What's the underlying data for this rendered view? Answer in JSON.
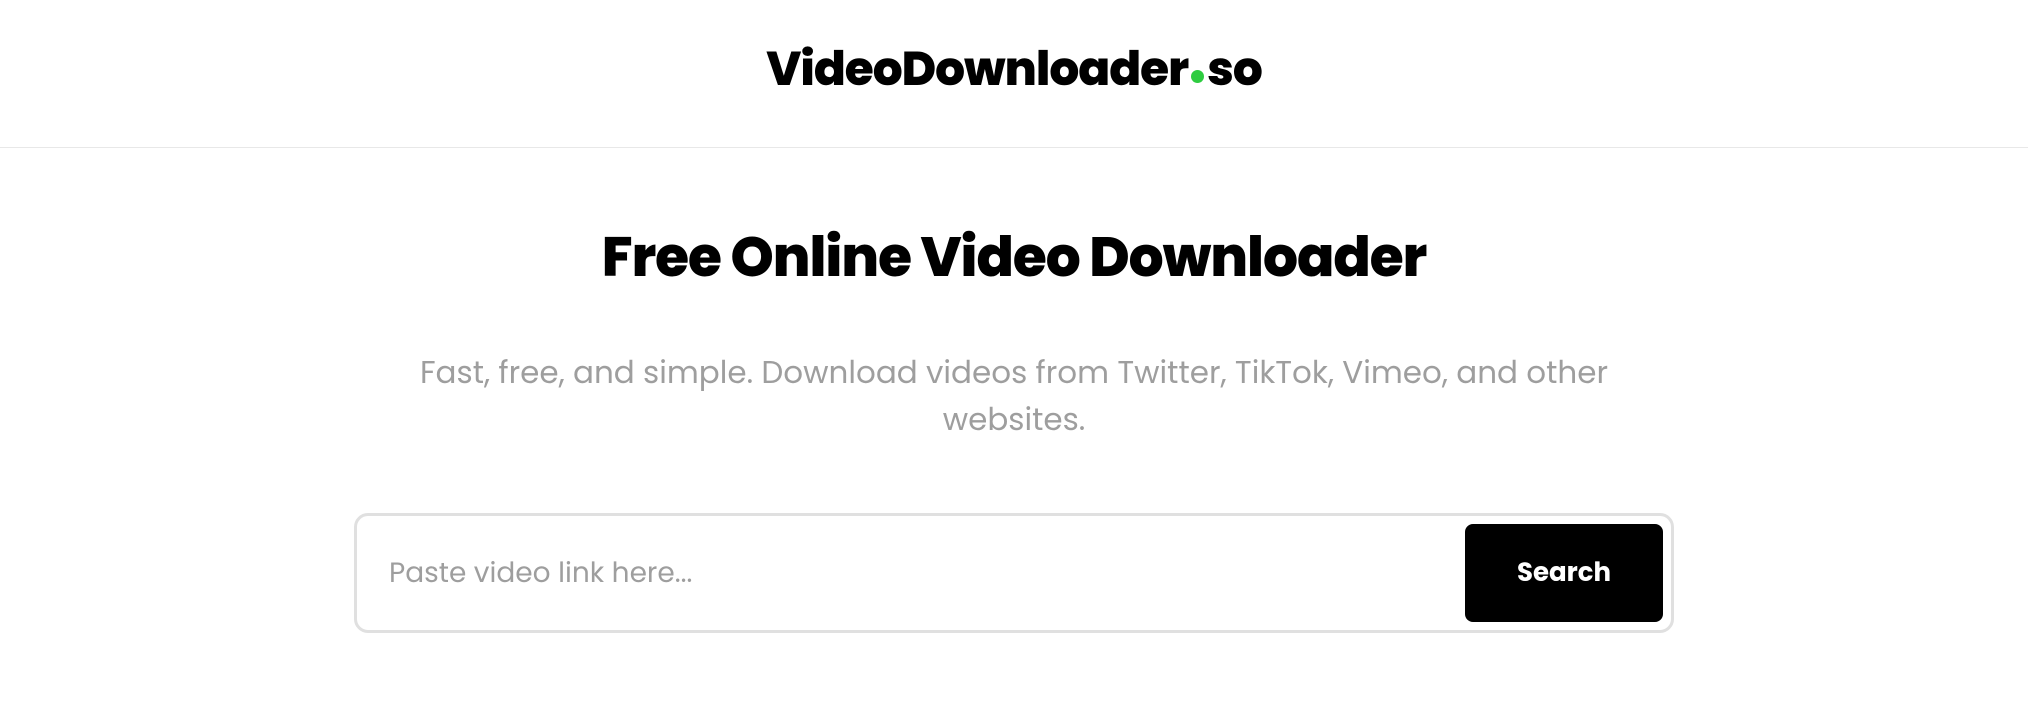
{
  "logo": {
    "part1": "VideoDownloader",
    "part2": "so"
  },
  "headline": "Free Online Video Downloader",
  "subheadline": "Fast, free, and simple. Download videos from Twitter, TikTok, Vimeo, and other websites.",
  "search": {
    "placeholder": "Paste video link here...",
    "button_label": "Search"
  }
}
